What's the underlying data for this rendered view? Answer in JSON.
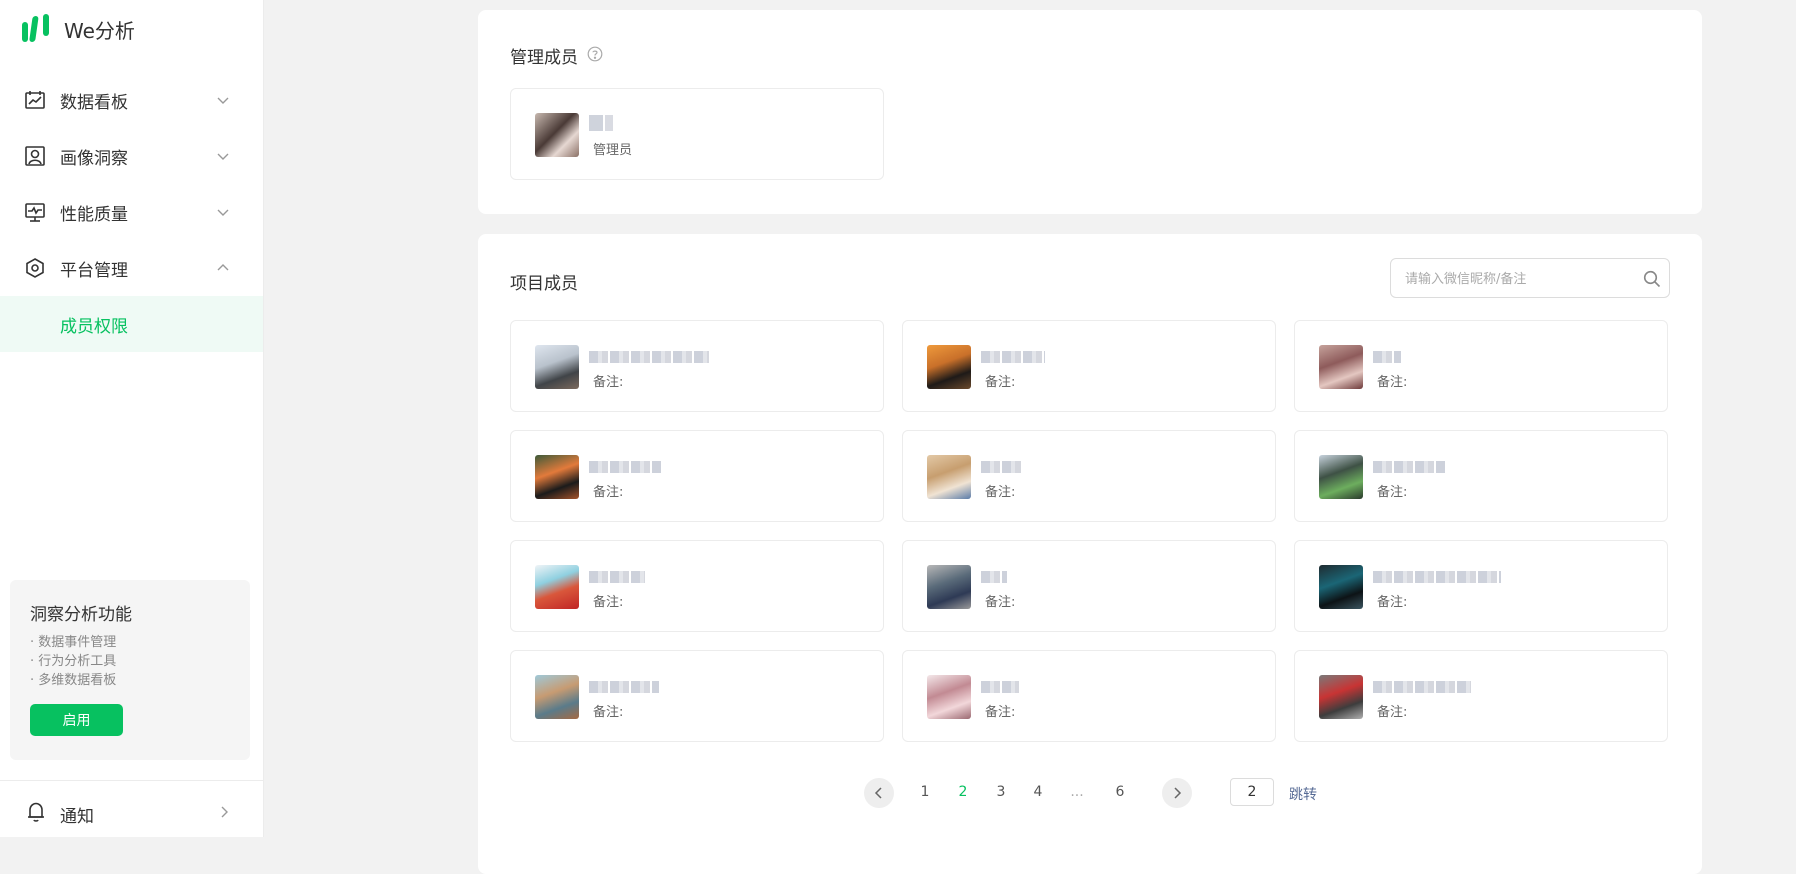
{
  "brand": {
    "name": "We分析",
    "logo_color": "#07c160"
  },
  "sidebar": {
    "items": [
      {
        "label": "数据看板",
        "icon": "dashboard-icon",
        "expanded": false
      },
      {
        "label": "画像洞察",
        "icon": "portrait-icon",
        "expanded": false
      },
      {
        "label": "性能质量",
        "icon": "monitor-icon",
        "expanded": false
      },
      {
        "label": "平台管理",
        "icon": "settings-hexagon-icon",
        "expanded": true
      }
    ],
    "sub_item": {
      "label": "成员权限",
      "active": true
    },
    "promo": {
      "title": "洞察分析功能",
      "features": [
        "· 数据事件管理",
        "· 行为分析工具",
        "· 多维数据看板"
      ],
      "button_label": "启用"
    },
    "notification": {
      "label": "通知",
      "icon": "bell-icon"
    }
  },
  "admin_section": {
    "title": "管理成员",
    "help_icon": "help-circle-icon",
    "member": {
      "role": "管理员"
    }
  },
  "project_section": {
    "title": "项目成员",
    "search_placeholder": "请输入微信昵称/备注",
    "remark_label": "备注:",
    "member_count_on_page": 12
  },
  "pagination": {
    "pages": [
      "1",
      "2",
      "3",
      "4",
      "...",
      "6"
    ],
    "current": "2",
    "jump_value": "2",
    "jump_label": "跳转"
  },
  "colors": {
    "accent": "#07c160",
    "active_bg": "#effaf5",
    "link": "#576b95",
    "page_bg": "#f2f2f2"
  }
}
